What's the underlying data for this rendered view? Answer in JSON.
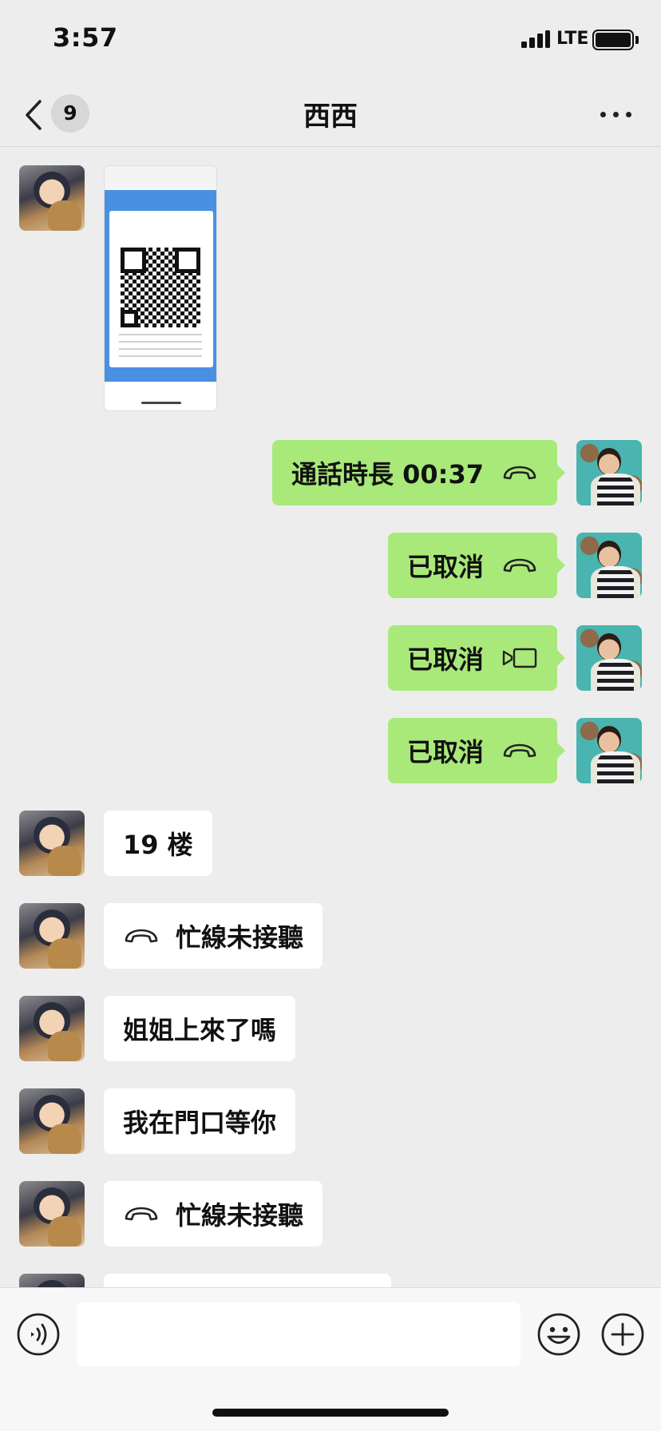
{
  "status_bar": {
    "time": "3:57",
    "network": "LTE",
    "icons": [
      "cellular-signal-icon",
      "battery-icon"
    ]
  },
  "nav": {
    "back_icon": "chevron-left-icon",
    "unread_count": "9",
    "title": "西西",
    "more_icon": "ellipsis-icon"
  },
  "messages": [
    {
      "sender": "friend",
      "type": "image",
      "image_desc": "QR code screenshot"
    },
    {
      "sender": "me",
      "type": "call",
      "text": "通話時長 00:37",
      "icon": "phone-icon"
    },
    {
      "sender": "me",
      "type": "call",
      "text": "已取消",
      "icon": "phone-icon"
    },
    {
      "sender": "me",
      "type": "call",
      "text": "已取消",
      "icon": "video-call-icon"
    },
    {
      "sender": "me",
      "type": "call",
      "text": "已取消",
      "icon": "phone-icon"
    },
    {
      "sender": "friend",
      "type": "text",
      "text": "19 楼"
    },
    {
      "sender": "friend",
      "type": "call",
      "text": "忙線未接聽",
      "icon": "phone-icon"
    },
    {
      "sender": "friend",
      "type": "text",
      "text": "姐姐上來了嗎"
    },
    {
      "sender": "friend",
      "type": "text",
      "text": "我在門口等你"
    },
    {
      "sender": "friend",
      "type": "call",
      "text": "忙線未接聽",
      "icon": "phone-icon"
    }
  ],
  "input_bar": {
    "voice_icon": "voice-icon",
    "placeholder": "",
    "value": "",
    "emoji_icon": "emoji-icon",
    "plus_icon": "plus-icon"
  },
  "colors": {
    "background": "#ededed",
    "outgoing_bubble": "#a9e97a",
    "incoming_bubble": "#ffffff"
  }
}
